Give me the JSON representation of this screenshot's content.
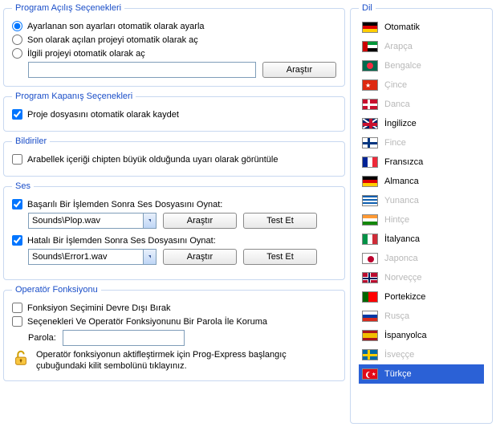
{
  "startup": {
    "legend": "Program Açılış Seçenekleri",
    "opt1": "Ayarlanan son ayarları otomatik olarak ayarla",
    "opt2": "Son olarak açılan projeyi otomatik olarak aç",
    "opt3": "İlgili projeyi otomatik olarak aç",
    "path_value": "",
    "browse": "Araştır",
    "selected": "opt1"
  },
  "shutdown": {
    "legend": "Program Kapanış Seçenekleri",
    "save_project": "Proje dosyasını otomatik olarak kaydet",
    "save_project_checked": true
  },
  "notices": {
    "legend": "Bildiriler",
    "buffer_warn": "Arabellek içeriği chipten büyük olduğunda uyarı olarak görüntüle",
    "buffer_warn_checked": false
  },
  "sound": {
    "legend": "Ses",
    "success_label": "Başarılı Bir İşlemden Sonra Ses Dosyasını Oynat:",
    "success_checked": true,
    "success_file": "Sounds\\Plop.wav",
    "error_label": "Hatalı Bir İşlemden Sonra Ses Dosyasını Oynat:",
    "error_checked": true,
    "error_file": "Sounds\\Error1.wav",
    "browse": "Araştır",
    "test": "Test Et"
  },
  "operator": {
    "legend": "Operatör Fonksiyonu",
    "disable_func": "Fonksiyon Seçimini Devre Dışı Bırak",
    "disable_func_checked": false,
    "pw_protect": "Seçenekleri Ve Operatör Fonksiyonunu Bir Parola İle Koruma",
    "pw_protect_checked": false,
    "pw_label": "Parola:",
    "pw_value": "",
    "hint": "Operatör fonksiyonun aktifleştirmek için Prog-Express başlangıç çubuğundaki kilit sembolünü tıklayınız."
  },
  "lang": {
    "legend": "Dil",
    "selected": "Türkçe",
    "items": [
      {
        "name": "Otomatik",
        "greyed": false,
        "flag": "de"
      },
      {
        "name": "Arapça",
        "greyed": true,
        "flag": "ae"
      },
      {
        "name": "Bengalce",
        "greyed": true,
        "flag": "bd"
      },
      {
        "name": "Çince",
        "greyed": true,
        "flag": "cn"
      },
      {
        "name": "Danca",
        "greyed": true,
        "flag": "dk"
      },
      {
        "name": "İngilizce",
        "greyed": false,
        "flag": "gb"
      },
      {
        "name": "Fince",
        "greyed": true,
        "flag": "fi"
      },
      {
        "name": "Fransızca",
        "greyed": false,
        "flag": "fr"
      },
      {
        "name": "Almanca",
        "greyed": false,
        "flag": "de"
      },
      {
        "name": "Yunanca",
        "greyed": true,
        "flag": "gr"
      },
      {
        "name": "Hintçe",
        "greyed": true,
        "flag": "in"
      },
      {
        "name": "İtalyanca",
        "greyed": false,
        "flag": "it"
      },
      {
        "name": "Japonca",
        "greyed": true,
        "flag": "jp"
      },
      {
        "name": "Norveççe",
        "greyed": true,
        "flag": "no"
      },
      {
        "name": "Portekizce",
        "greyed": false,
        "flag": "pt"
      },
      {
        "name": "Rusça",
        "greyed": true,
        "flag": "ru"
      },
      {
        "name": "İspanyolca",
        "greyed": false,
        "flag": "es"
      },
      {
        "name": "İsveççe",
        "greyed": true,
        "flag": "se"
      },
      {
        "name": "Türkçe",
        "greyed": false,
        "flag": "tr"
      }
    ]
  }
}
